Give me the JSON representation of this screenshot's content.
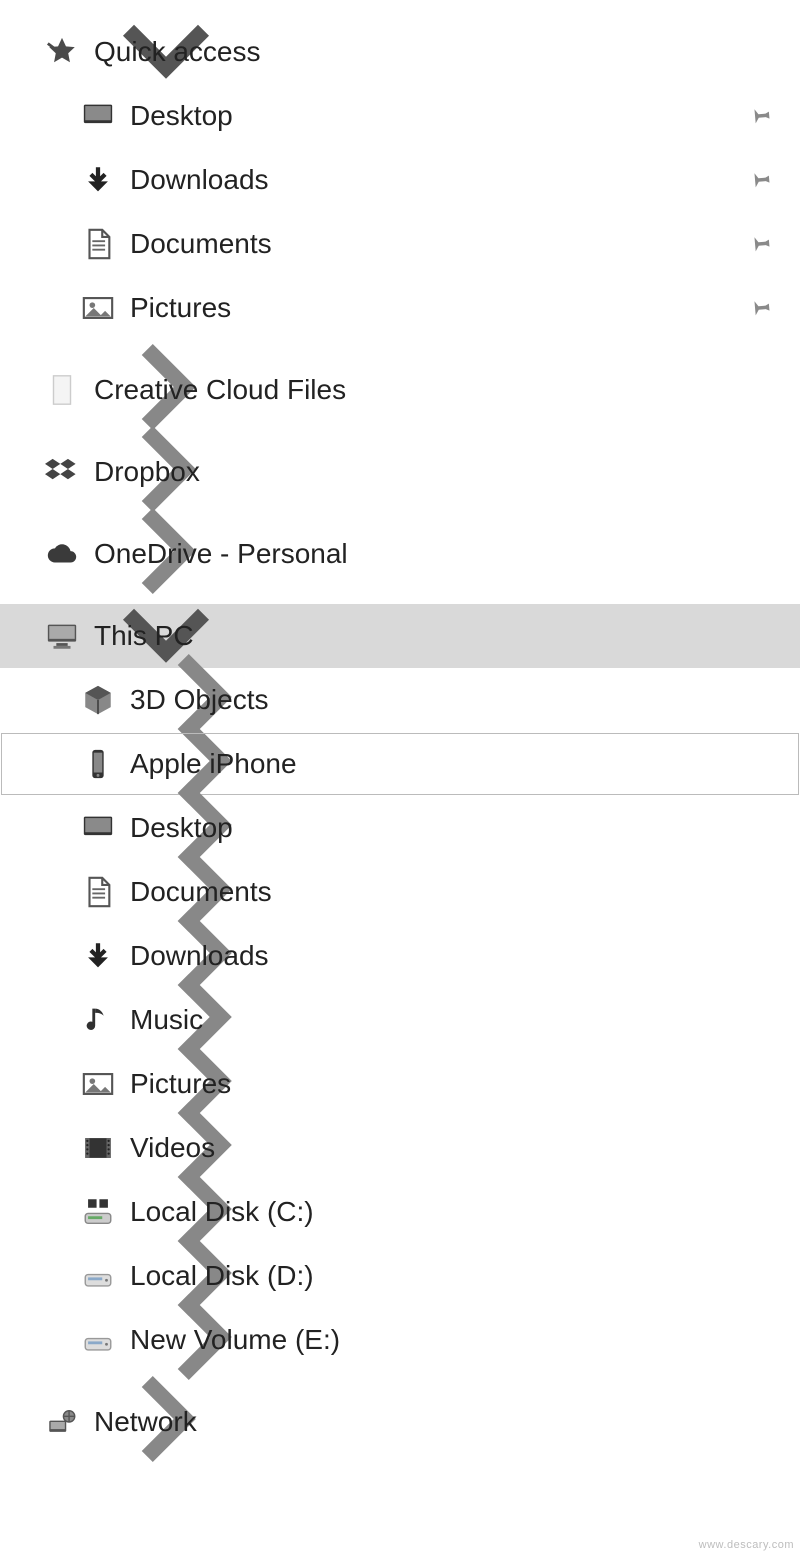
{
  "watermark": "www.descary.com",
  "tree": {
    "quick_access": {
      "label": "Quick access",
      "children": [
        {
          "id": "desktop",
          "label": "Desktop",
          "pinned": true
        },
        {
          "id": "downloads",
          "label": "Downloads",
          "pinned": true
        },
        {
          "id": "documents",
          "label": "Documents",
          "pinned": true
        },
        {
          "id": "pictures",
          "label": "Pictures",
          "pinned": true
        }
      ]
    },
    "creative_cloud": {
      "label": "Creative Cloud Files"
    },
    "dropbox": {
      "label": "Dropbox"
    },
    "onedrive": {
      "label": "OneDrive - Personal"
    },
    "this_pc": {
      "label": "This PC",
      "selected": true,
      "children": [
        {
          "id": "3d_objects",
          "label": "3D Objects"
        },
        {
          "id": "apple_iphone",
          "label": "Apple iPhone",
          "highlight": true
        },
        {
          "id": "pc_desktop",
          "label": "Desktop"
        },
        {
          "id": "pc_documents",
          "label": "Documents"
        },
        {
          "id": "pc_downloads",
          "label": "Downloads"
        },
        {
          "id": "pc_music",
          "label": "Music"
        },
        {
          "id": "pc_pictures",
          "label": "Pictures"
        },
        {
          "id": "pc_videos",
          "label": "Videos"
        },
        {
          "id": "disk_c",
          "label": "Local Disk (C:)"
        },
        {
          "id": "disk_d",
          "label": "Local Disk (D:)"
        },
        {
          "id": "disk_e",
          "label": "New Volume (E:)"
        }
      ]
    },
    "network": {
      "label": "Network"
    }
  }
}
